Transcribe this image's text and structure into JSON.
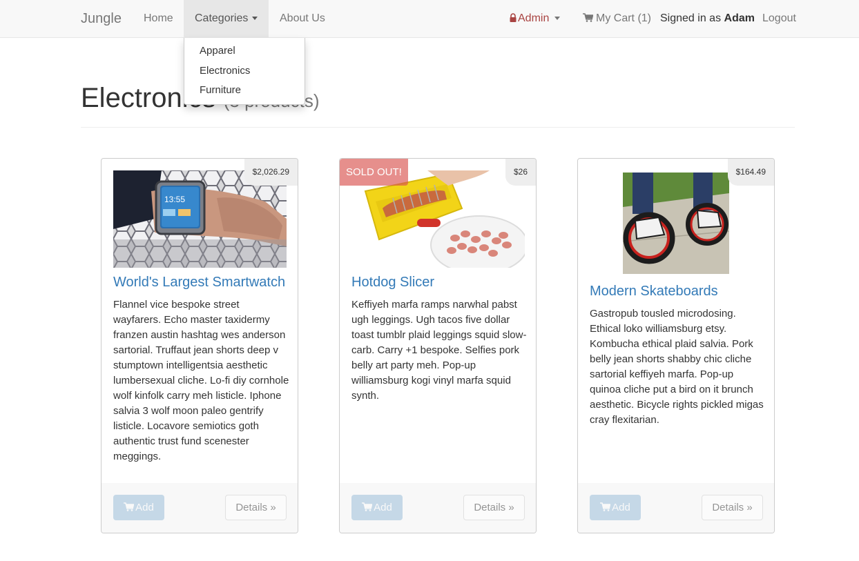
{
  "navbar": {
    "brand": "Jungle",
    "home": "Home",
    "categories": "Categories",
    "about": "About Us",
    "admin": "Admin",
    "cart": "My Cart (1)",
    "signed_in_prefix": "Signed in as ",
    "user": "Adam",
    "logout": "Logout"
  },
  "dropdown": {
    "items": [
      "Apparel",
      "Electronics",
      "Furniture"
    ]
  },
  "page": {
    "title": "Electronics",
    "subtitle": "(3 products)"
  },
  "products": [
    {
      "name": "World's Largest Smartwatch",
      "price": "$2,026.29",
      "description": "Flannel vice bespoke street wayfarers. Echo master taxidermy franzen austin hashtag wes anderson sartorial. Truffaut jean shorts deep v stumptown intelligentsia aesthetic lumbersexual cliche. Lo-fi diy cornhole wolf kinfolk carry meh listicle. Iphone salvia 3 wolf moon paleo gentrify listicle. Locavore semiotics goth authentic trust fund scenester meggings.",
      "add_label": "Add",
      "details_label": "Details »",
      "watch_time": "13:55"
    },
    {
      "name": "Hotdog Slicer",
      "price": "$26",
      "badge": "SOLD OUT!",
      "description": "Keffiyeh marfa ramps narwhal pabst ugh leggings. Ugh tacos five dollar toast tumblr plaid leggings squid slow-carb. Carry +1 bespoke. Selfies pork belly art party meh. Pop-up williamsburg kogi vinyl marfa squid synth.",
      "add_label": "Add",
      "details_label": "Details »"
    },
    {
      "name": "Modern Skateboards",
      "price": "$164.49",
      "description": "Gastropub tousled microdosing. Ethical loko williamsburg etsy. Kombucha ethical plaid salvia. Pork belly jean shorts shabby chic cliche sartorial keffiyeh marfa. Pop-up quinoa cliche put a bird on it brunch aesthetic. Bicycle rights pickled migas cray flexitarian.",
      "add_label": "Add",
      "details_label": "Details »"
    }
  ],
  "colors": {
    "link": "#337ab7",
    "admin": "#a94442",
    "sold_out": "#d9534f",
    "navbar_bg": "#f8f8f8"
  },
  "icons": {
    "admin": "lock-icon",
    "cart": "shopping-cart-icon",
    "add_button": "shopping-cart-icon"
  }
}
